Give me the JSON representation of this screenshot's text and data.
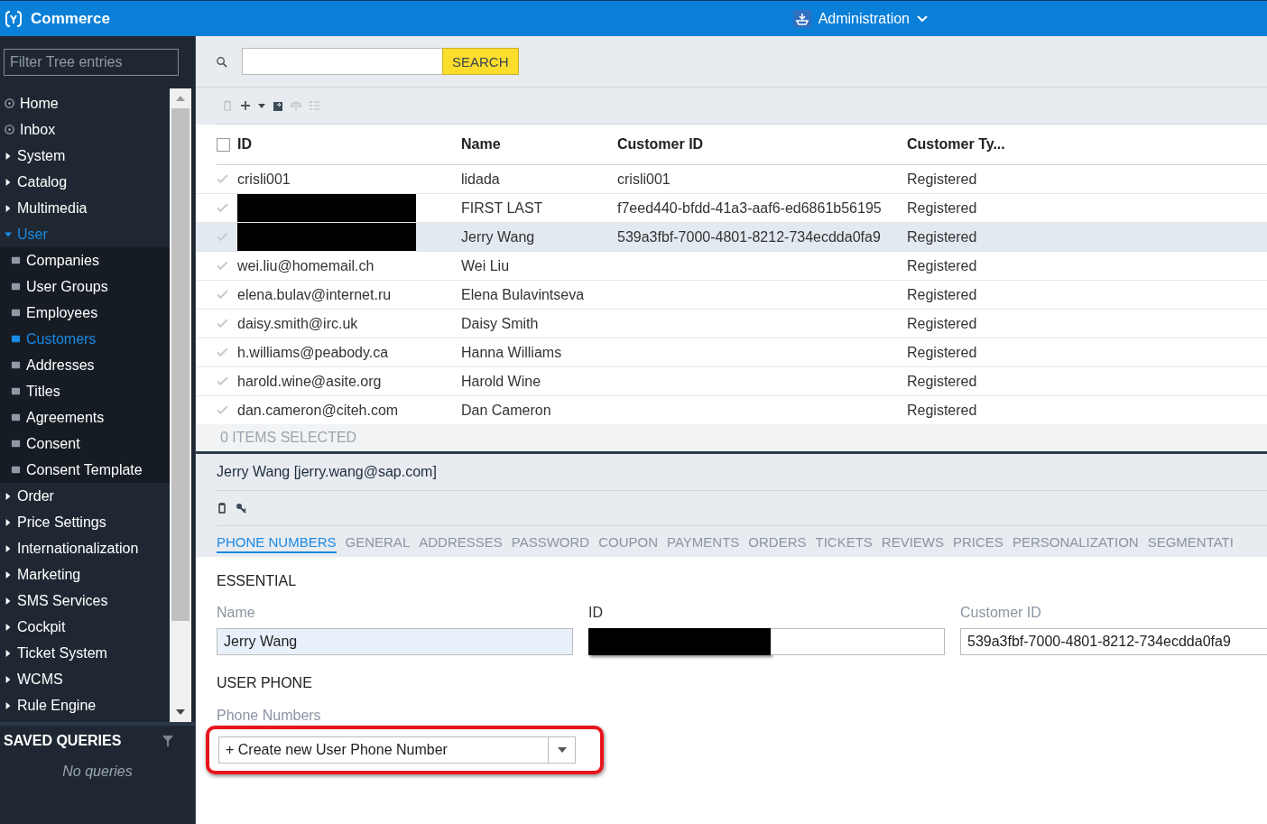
{
  "header": {
    "app_title": "Commerce",
    "perspective": "Administration"
  },
  "sidebar": {
    "filter": {
      "placeholder": "Filter Tree entries"
    },
    "tree": [
      {
        "label": "Home",
        "kind": "link",
        "expanded": false
      },
      {
        "label": "Inbox",
        "kind": "link",
        "expanded": false
      },
      {
        "label": "System",
        "kind": "folder",
        "expanded": false
      },
      {
        "label": "Catalog",
        "kind": "folder",
        "expanded": false
      },
      {
        "label": "Multimedia",
        "kind": "folder",
        "expanded": false
      },
      {
        "label": "User",
        "kind": "folder",
        "expanded": true,
        "children": [
          {
            "label": "Companies",
            "selected": false
          },
          {
            "label": "User Groups",
            "selected": false
          },
          {
            "label": "Employees",
            "selected": false
          },
          {
            "label": "Customers",
            "selected": true
          },
          {
            "label": "Addresses",
            "selected": false
          },
          {
            "label": "Titles",
            "selected": false
          },
          {
            "label": "Agreements",
            "selected": false
          },
          {
            "label": "Consent",
            "selected": false
          },
          {
            "label": "Consent Template",
            "selected": false
          }
        ]
      },
      {
        "label": "Order",
        "kind": "folder",
        "expanded": false
      },
      {
        "label": "Price Settings",
        "kind": "folder",
        "expanded": false
      },
      {
        "label": "Internationalization",
        "kind": "folder",
        "expanded": false
      },
      {
        "label": "Marketing",
        "kind": "folder",
        "expanded": false
      },
      {
        "label": "SMS Services",
        "kind": "folder",
        "expanded": false
      },
      {
        "label": "Cockpit",
        "kind": "folder",
        "expanded": false
      },
      {
        "label": "Ticket System",
        "kind": "folder",
        "expanded": false
      },
      {
        "label": "WCMS",
        "kind": "folder",
        "expanded": false
      },
      {
        "label": "Rule Engine",
        "kind": "folder",
        "expanded": false
      }
    ],
    "saved_queries": {
      "title": "SAVED QUERIES",
      "empty": "No queries"
    }
  },
  "search": {
    "button": "SEARCH"
  },
  "table": {
    "columns": [
      "ID",
      "Name",
      "Customer ID",
      "Customer Ty..."
    ],
    "all_checked": false,
    "rows": [
      {
        "cells": [
          "crisli001",
          "lidada",
          "crisli001",
          "Registered"
        ],
        "selected": false,
        "redacted": false
      },
      {
        "cells": [
          "",
          "FIRST LAST",
          "f7eed440-bfdd-41a3-aaf6-ed6861b56195",
          "Registered"
        ],
        "selected": false,
        "redacted": true
      },
      {
        "cells": [
          "",
          "Jerry Wang",
          "539a3fbf-7000-4801-8212-734ecdda0fa9",
          "Registered"
        ],
        "selected": true,
        "redacted": true
      },
      {
        "cells": [
          "wei.liu@homemail.ch",
          "Wei Liu",
          "",
          "Registered"
        ],
        "selected": false,
        "redacted": false
      },
      {
        "cells": [
          "elena.bulav@internet.ru",
          "Elena Bulavintseva",
          "",
          "Registered"
        ],
        "selected": false,
        "redacted": false
      },
      {
        "cells": [
          "daisy.smith@irc.uk",
          "Daisy Smith",
          "",
          "Registered"
        ],
        "selected": false,
        "redacted": false
      },
      {
        "cells": [
          "h.williams@peabody.ca",
          "Hanna Williams",
          "",
          "Registered"
        ],
        "selected": false,
        "redacted": false
      },
      {
        "cells": [
          "harold.wine@asite.org",
          "Harold Wine",
          "",
          "Registered"
        ],
        "selected": false,
        "redacted": false
      },
      {
        "cells": [
          "dan.cameron@citeh.com",
          "Dan Cameron",
          "",
          "Registered"
        ],
        "selected": false,
        "redacted": false
      }
    ],
    "footer": "0 ITEMS SELECTED"
  },
  "detail": {
    "title": "Jerry Wang [jerry.wang@sap.com]",
    "tabs": [
      {
        "label": "PHONE NUMBERS",
        "selected": true
      },
      {
        "label": "GENERAL",
        "selected": false
      },
      {
        "label": "ADDRESSES",
        "selected": false
      },
      {
        "label": "PASSWORD",
        "selected": false
      },
      {
        "label": "COUPON",
        "selected": false
      },
      {
        "label": "PAYMENTS",
        "selected": false
      },
      {
        "label": "ORDERS",
        "selected": false
      },
      {
        "label": "TICKETS",
        "selected": false
      },
      {
        "label": "REVIEWS",
        "selected": false
      },
      {
        "label": "PRICES",
        "selected": false
      },
      {
        "label": "PERSONALIZATION",
        "selected": false
      },
      {
        "label": "SEGMENTATI",
        "selected": false
      }
    ],
    "essential": {
      "title": "ESSENTIAL",
      "fields": [
        {
          "label": "Name",
          "value": "Jerry Wang"
        },
        {
          "label": "ID",
          "redacted": true
        },
        {
          "label": "Customer ID",
          "value": "539a3fbf-7000-4801-8212-734ecdda0fa9"
        }
      ]
    },
    "user_phone": {
      "title": "USER PHONE",
      "label": "Phone Numbers",
      "icon": "+",
      "combo": "Create new User Phone Number",
      "highlighted": true
    }
  }
}
